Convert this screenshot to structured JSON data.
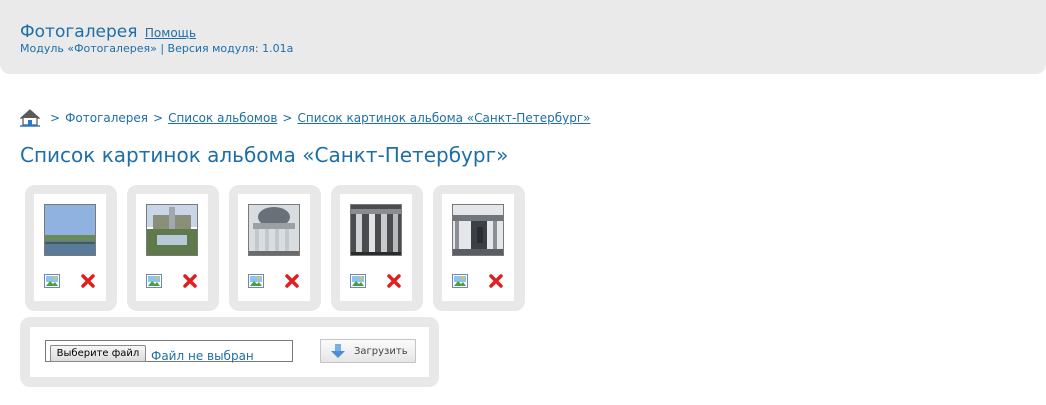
{
  "header": {
    "title": "Фотогалерея",
    "help_link": "Помощь",
    "subtitle": "Модуль «Фотогалерея» | Версия модуля: 1.01a"
  },
  "breadcrumb": {
    "home_icon": "home-icon",
    "separator": ">",
    "items": [
      {
        "label": "Фотогалерея",
        "link": false
      },
      {
        "label": "Список альбомов",
        "link": true
      },
      {
        "label": "Список картинок альбома «Санкт-Петербург»",
        "link": true
      }
    ]
  },
  "page_title": "Список картинок альбома «Санкт-Петербург»",
  "thumbnails": [
    {
      "image": "photo-river-embankment",
      "edit_icon": "edit-image-icon",
      "delete_icon": "delete-icon"
    },
    {
      "image": "photo-fountain-palace",
      "edit_icon": "edit-image-icon",
      "delete_icon": "delete-icon"
    },
    {
      "image": "photo-cathedral-portico",
      "edit_icon": "edit-image-icon",
      "delete_icon": "delete-icon"
    },
    {
      "image": "photo-columns",
      "edit_icon": "edit-image-icon",
      "delete_icon": "delete-icon"
    },
    {
      "image": "photo-cathedral-monument",
      "edit_icon": "edit-image-icon",
      "delete_icon": "delete-icon"
    }
  ],
  "upload": {
    "choose_file_label": "Выберите файл",
    "file_status": "Файл не выбран",
    "upload_button_label": "Загрузить"
  },
  "colors": {
    "accent": "#1e6ea8",
    "header_bg": "#eaeaea",
    "card_bg": "#e8e8e8",
    "delete_red": "#e02020"
  }
}
